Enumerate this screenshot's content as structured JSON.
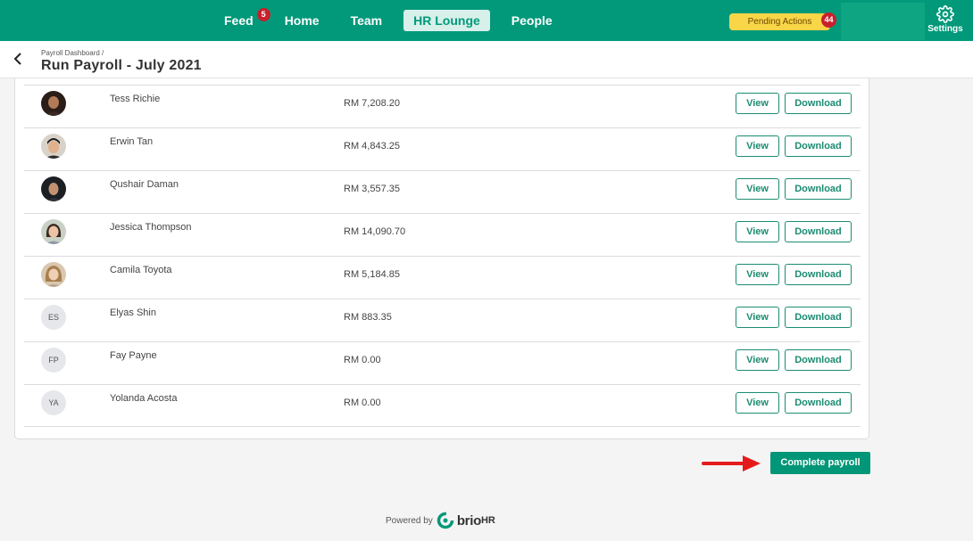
{
  "nav": {
    "items": [
      {
        "label": "Feed",
        "badge": "5"
      },
      {
        "label": "Home"
      },
      {
        "label": "Team"
      },
      {
        "label": "HR Lounge",
        "active": true
      },
      {
        "label": "People"
      }
    ],
    "pending_label": "Pending Actions",
    "pending_count": "44",
    "settings_label": "Settings"
  },
  "header": {
    "breadcrumb": "Payroll Dashboard /",
    "title": "Run Payroll - July 2021"
  },
  "table": {
    "view_label": "View",
    "download_label": "Download",
    "rows": [
      {
        "name": "Tess Richie",
        "amount": "RM 7,208.20",
        "avatar": "photo"
      },
      {
        "name": "Erwin Tan",
        "amount": "RM 4,843.25",
        "avatar": "photo"
      },
      {
        "name": "Qushair Daman",
        "amount": "RM 3,557.35",
        "avatar": "photo"
      },
      {
        "name": "Jessica Thompson",
        "amount": "RM 14,090.70",
        "avatar": "photo"
      },
      {
        "name": "Camila Toyota",
        "amount": "RM 5,184.85",
        "avatar": "photo"
      },
      {
        "name": "Elyas Shin",
        "amount": "RM 883.35",
        "initials": "ES"
      },
      {
        "name": "Fay Payne",
        "amount": "RM 0.00",
        "initials": "FP"
      },
      {
        "name": "Yolanda Acosta",
        "amount": "RM 0.00",
        "initials": "YA"
      }
    ]
  },
  "actions": {
    "complete_label": "Complete payroll"
  },
  "footer": {
    "powered_by": "Powered by",
    "brand": "brio",
    "brand_suffix": "HR"
  },
  "colors": {
    "brand_green": "#01997a",
    "badge_red": "#c8202c",
    "pending_yellow": "#f9d548",
    "arrow_red": "#e51b1b"
  }
}
